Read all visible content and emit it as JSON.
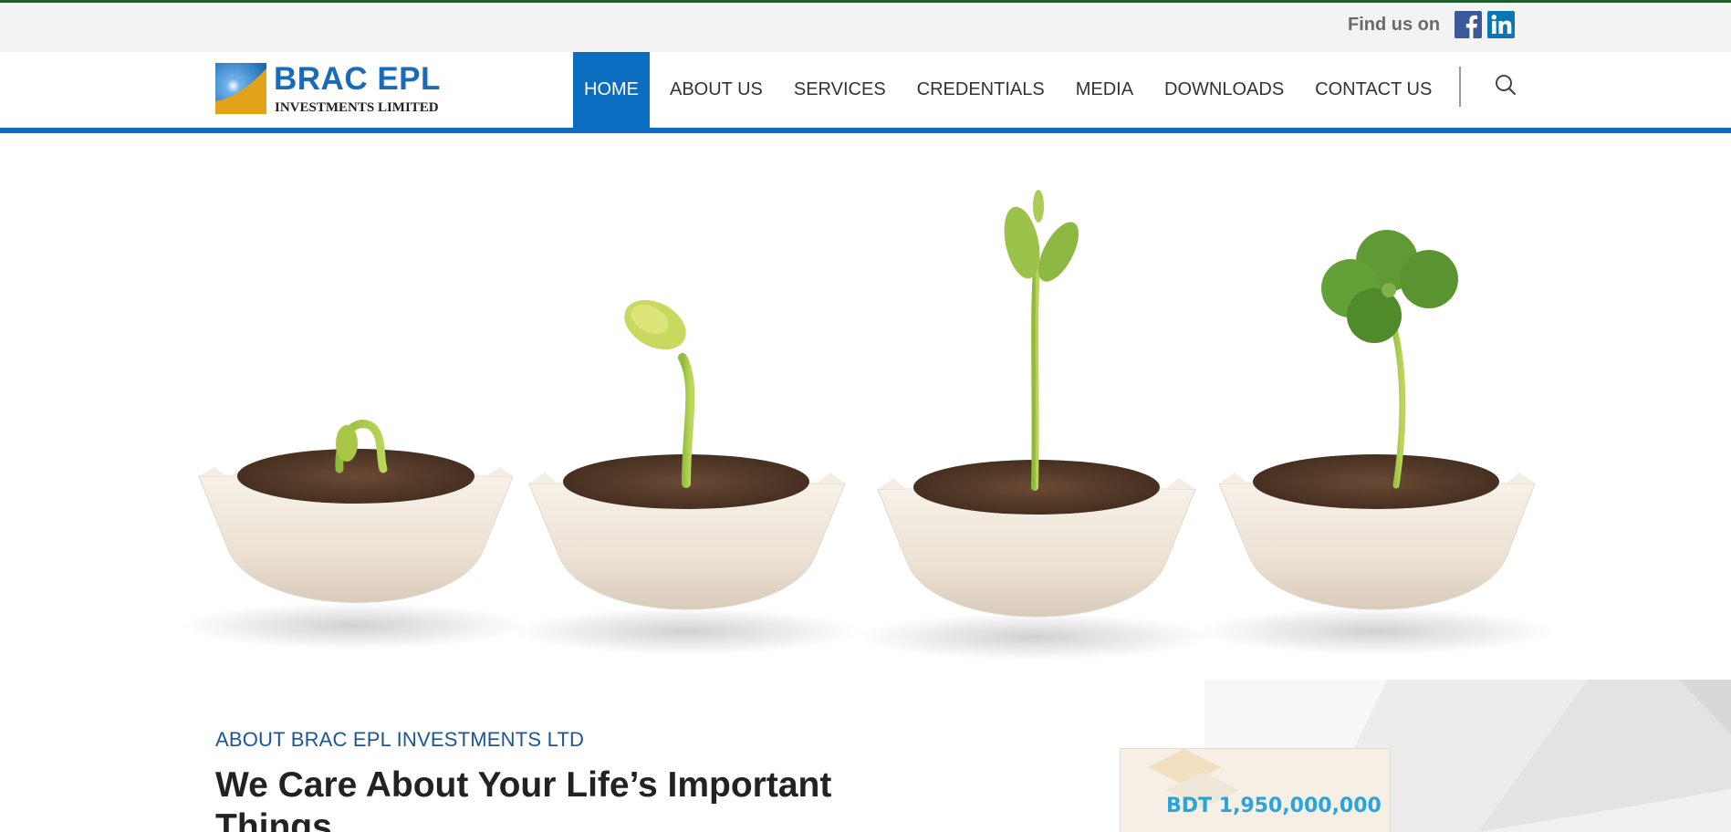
{
  "topbar": {
    "find_us_label": "Find us on",
    "social": [
      {
        "name": "facebook",
        "icon": "facebook-icon",
        "color": "#3b5998"
      },
      {
        "name": "linkedin",
        "icon": "linkedin-icon",
        "color": "#0a77b5"
      }
    ]
  },
  "logo": {
    "title": "BRAC EPL",
    "subtitle": "INVESTMENTS LIMITED"
  },
  "nav": {
    "items": [
      {
        "label": "HOME",
        "active": true
      },
      {
        "label": "ABOUT US",
        "active": false
      },
      {
        "label": "SERVICES",
        "active": false
      },
      {
        "label": "CREDENTIALS",
        "active": false
      },
      {
        "label": "MEDIA",
        "active": false
      },
      {
        "label": "DOWNLOADS",
        "active": false
      },
      {
        "label": "CONTACT US",
        "active": false
      }
    ],
    "search_icon": "search-icon"
  },
  "hero": {
    "image": "seedlings-in-pots"
  },
  "about": {
    "kicker": "ABOUT BRAC EPL INVESTMENTS LTD",
    "title": "We Care About Your Life’s Important Things"
  },
  "stat": {
    "value": "BDT 1,950,000,000"
  },
  "colors": {
    "brand_blue": "#0b6dbf",
    "logo_blue": "#1a6ab7",
    "logo_gold": "#e2a21a",
    "kicker_blue": "#1b5599",
    "stat_blue": "#29a4dd",
    "top_strip_green": "#1f5e2e"
  }
}
